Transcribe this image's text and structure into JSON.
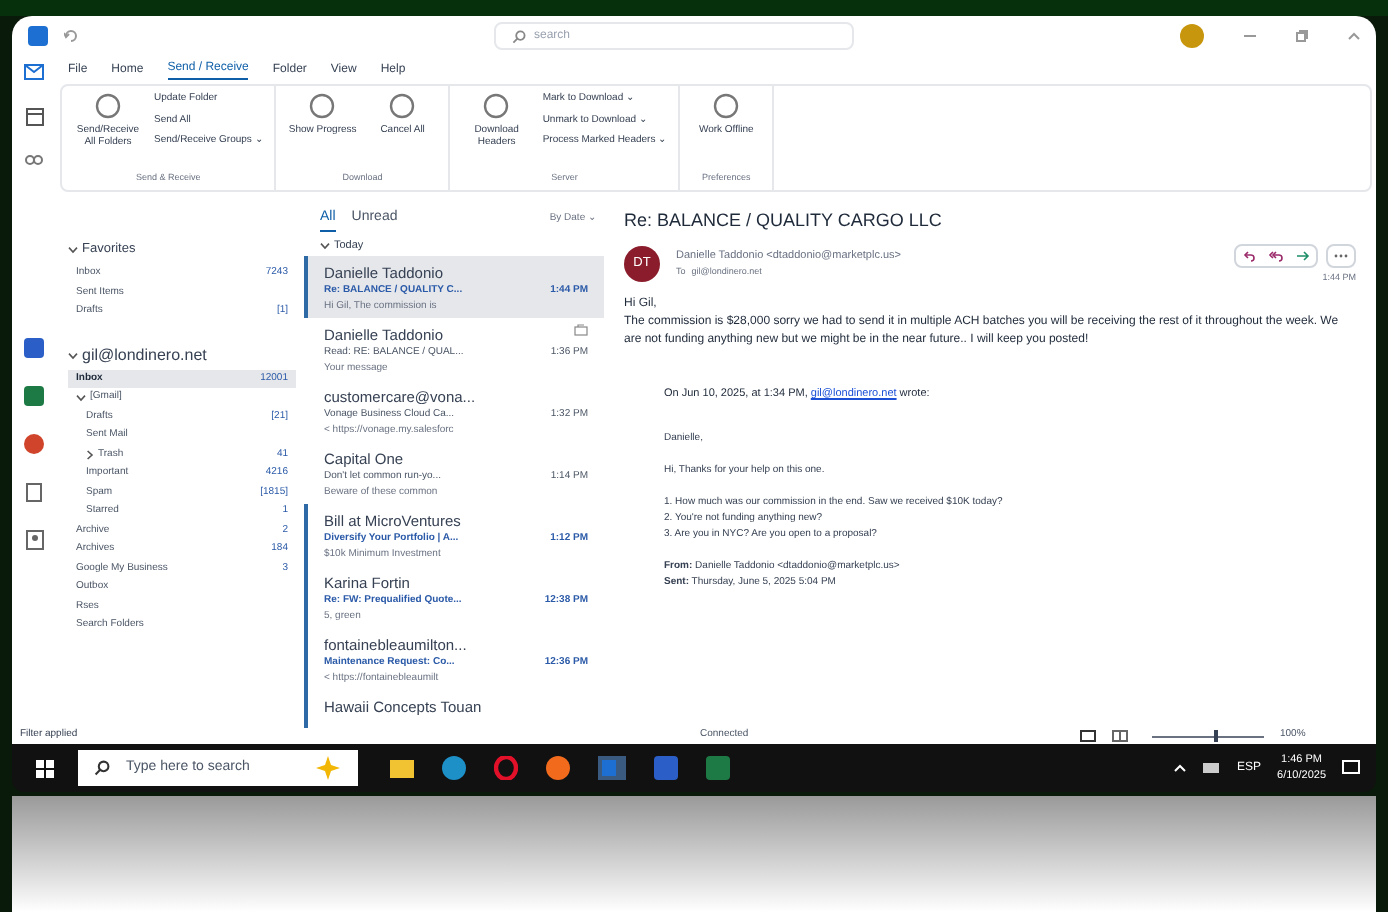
{
  "title_bar": {
    "search_placeholder": "search"
  },
  "ribbon_tabs": [
    {
      "label": "File",
      "selected": false
    },
    {
      "label": "Home",
      "selected": false
    },
    {
      "label": "Send / Receive",
      "selected": true
    },
    {
      "label": "Folder",
      "selected": false
    },
    {
      "label": "View",
      "selected": false
    },
    {
      "label": "Help",
      "selected": false
    }
  ],
  "ribbon_groups": [
    {
      "label": "Send & Receive",
      "items": [
        {
          "kind": "large",
          "label": "Send/Receive All Folders"
        },
        {
          "kind": "stack",
          "items": [
            "Update Folder",
            "Send All",
            "Send/Receive Groups ⌄"
          ]
        }
      ]
    },
    {
      "label": "Download",
      "items": [
        {
          "kind": "large",
          "label": "Show Progress"
        },
        {
          "kind": "large",
          "label": "Cancel All"
        }
      ]
    },
    {
      "label": "Server",
      "items": [
        {
          "kind": "large",
          "label": "Download Headers"
        },
        {
          "kind": "stack",
          "items": [
            "Mark to Download ⌄",
            "Unmark to Download ⌄",
            "Process Marked Headers ⌄"
          ]
        }
      ]
    },
    {
      "label": "Preferences",
      "items": [
        {
          "kind": "large",
          "label": "Work Offline"
        }
      ]
    }
  ],
  "folders": [
    {
      "label": "Favorites",
      "expanded": true,
      "heading": true,
      "children": [
        {
          "label": "Inbox",
          "count": "7243",
          "selected": false
        },
        {
          "label": "Sent Items",
          "selected": false
        },
        {
          "label": "Drafts",
          "count": "[1]",
          "selected": false
        }
      ]
    },
    {
      "label": "gil@londinero.net",
      "expanded": true,
      "heading": true,
      "children": [
        {
          "label": "Inbox",
          "count": "12001",
          "selected": true
        },
        {
          "label": "[Gmail]",
          "expanded": true,
          "children": [
            {
              "label": "Drafts",
              "count": "[21]",
              "selected": false
            },
            {
              "label": "Sent Mail",
              "selected": false
            },
            {
              "label": "Trash",
              "expanded": false,
              "count": "41",
              "selected": false
            },
            {
              "label": "Important",
              "count": "4216",
              "selected": false
            },
            {
              "label": "Spam",
              "count": "[1815]",
              "selected": false
            },
            {
              "label": "Starred",
              "count": "1",
              "selected": false
            }
          ]
        },
        {
          "label": "Archive",
          "count": "2",
          "selected": false
        },
        {
          "label": "Archives",
          "count": "184",
          "selected": false
        },
        {
          "label": "Google My Business",
          "count": "3",
          "selected": false
        },
        {
          "label": "Outbox",
          "selected": false
        },
        {
          "label": "Rses",
          "selected": false
        },
        {
          "label": "Search Folders",
          "selected": false
        }
      ]
    }
  ],
  "list_tabs": [
    {
      "label": "All",
      "selected": true
    },
    {
      "label": "Unread",
      "selected": false
    }
  ],
  "sort_label": "By Date ⌄",
  "group_label": "Today",
  "messages": [
    {
      "sender": "Danielle Taddonio",
      "subject": "Re: BALANCE / QUALITY C...",
      "preview": "Hi Gil, The commission is",
      "time": "1:44 PM",
      "unread": true,
      "selected": true,
      "replied": false
    },
    {
      "sender": "Danielle Taddonio",
      "subject": "Read: RE: BALANCE / QUAL...",
      "preview": "Your message",
      "time": "1:36 PM",
      "unread": false,
      "selected": false,
      "replied": true
    },
    {
      "sender": "customercare@vona...",
      "subject": "Vonage Business Cloud Ca...",
      "preview": "< https://vonage.my.salesforc",
      "time": "1:32 PM",
      "unread": false,
      "selected": false,
      "replied": false
    },
    {
      "sender": "Capital One",
      "subject": "Don't let common run-yo...",
      "preview": "Beware of these common",
      "time": "1:14 PM",
      "unread": false,
      "selected": false,
      "replied": false
    },
    {
      "sender": "Bill at MicroVentures",
      "subject": "Diversify Your Portfolio | A...",
      "preview": "$10k Minimum Investment",
      "time": "1:12 PM",
      "unread": true,
      "selected": false,
      "replied": false
    },
    {
      "sender": "Karina Fortin",
      "subject": "Re: FW: Prequalified Quote...",
      "preview": "5, green",
      "time": "12:38 PM",
      "unread": true,
      "selected": false,
      "replied": false
    },
    {
      "sender": "fontainebleaumilton...",
      "subject": "Maintenance Request: Co...",
      "preview": "< https://fontainebleaumilt",
      "time": "12:36 PM",
      "unread": true,
      "selected": false,
      "replied": false
    },
    {
      "sender": "Hawaii Concepts Touan",
      "unread": true,
      "selected": false,
      "replied": false
    }
  ],
  "reading": {
    "subject": "Re: BALANCE / QUALITY CARGO LLC",
    "initials": "DT",
    "from": "Danielle Taddonio <dtaddonio@marketplc.us>",
    "to_label": "To",
    "to": "gil@londinero.net",
    "time": "1:44 PM",
    "body": [
      "Hi Gil,",
      "The commission is $28,000 sorry we had to send it in multiple ACH batches you will be receiving the rest of it throughout the week. We are not funding anything new but we might be in the near future.. I will keep you posted!"
    ],
    "quote_intro": "On Jun 10, 2025, at 1:34 PM,",
    "quote_link": "gil@londinero.net",
    "quote_tail": "wrote:",
    "quote": [
      "Danielle,",
      "Hi, Thanks for your help on this one.",
      "1. How much was our commission in the end. Saw we received $10K today?\n2. You're not funding anything new?\n3. Are you in NYC? Are you open to a proposal?",
      "**From:** Danielle Taddonio <dtaddonio@marketplc.us>\n**Sent:** Thursday, June 5, 2025 5:04 PM"
    ]
  },
  "status": {
    "left": "Filter applied",
    "center": "Connected",
    "zoom": "100%",
    "zoom_slider": {
      "level": 0.55
    }
  },
  "taskbar": {
    "search_placeholder": "Type here to search",
    "tray_lang": "ESP",
    "time": "1:46 PM",
    "date": "6/10/2025"
  }
}
